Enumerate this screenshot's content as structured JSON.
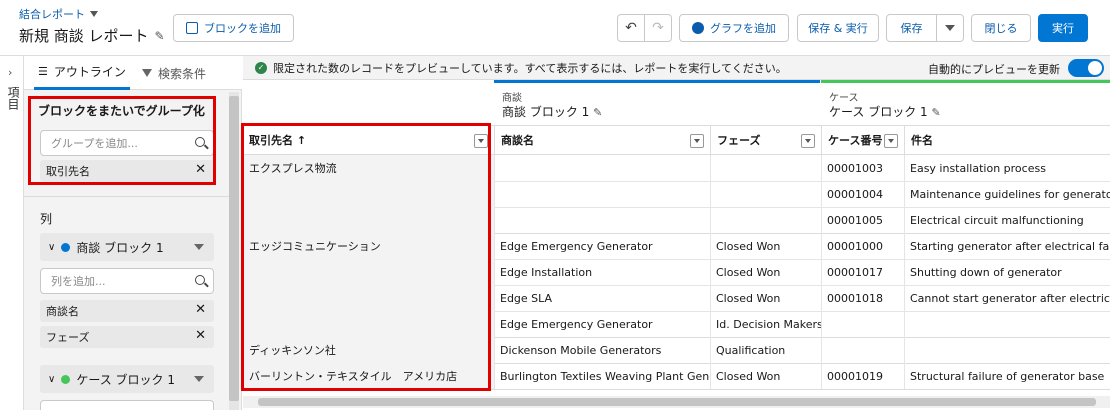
{
  "header": {
    "breadcrumb": "結合レポート",
    "title": "新規 商談 レポート",
    "add_block_label": "ブロックを追加",
    "add_chart_label": "グラフを追加",
    "save_run_label": "保存 & 実行",
    "save_label": "保存",
    "close_label": "閉じる",
    "run_label": "実行"
  },
  "left_strip": {
    "label": "項目"
  },
  "panel": {
    "tabs": [
      "アウトライン",
      "検索条件"
    ],
    "group_section_title": "ブロックをまたいでグループ化",
    "group_input_placeholder": "グループを追加...",
    "group_pills": [
      "取引先名"
    ],
    "columns_title": "列",
    "blocks": [
      {
        "name": "商談 ブロック 1",
        "color": "#0176d3",
        "input_placeholder": "列を追加...",
        "columns": [
          "商談名",
          "フェーズ"
        ]
      },
      {
        "name": "ケース ブロック 1",
        "color": "#45c65a",
        "input_placeholder": "列を追加...",
        "columns": []
      }
    ]
  },
  "notice": {
    "text": "限定された数のレコードをプレビューしています。すべて表示するには、レポートを実行してください。",
    "auto_preview_label": "自動的にプレビューを更新"
  },
  "report": {
    "blocks": [
      {
        "type": "商談",
        "name": "商談 ブロック 1",
        "color": "#0176d3"
      },
      {
        "type": "ケース",
        "name": "ケース ブロック 1",
        "color": "#45c65a"
      }
    ],
    "columns": [
      "取引先名 ↑",
      "商談名",
      "フェーズ",
      "ケース番号",
      "件名"
    ],
    "groups": [
      {
        "account": "エクスプレス物流",
        "opps": [],
        "cases": [
          [
            "00001003",
            "Easy installation process"
          ],
          [
            "00001004",
            "Maintenance guidelines for generator un"
          ],
          [
            "00001005",
            "Electrical circuit malfunctioning"
          ]
        ]
      },
      {
        "account": "エッジコミュニケーション",
        "opps": [
          [
            "Edge Emergency Generator",
            "Closed Won"
          ],
          [
            "Edge Installation",
            "Closed Won"
          ],
          [
            "Edge SLA",
            "Closed Won"
          ],
          [
            "Edge Emergency Generator",
            "Id. Decision Makers"
          ]
        ],
        "cases": [
          [
            "00001000",
            "Starting generator after electrical failure"
          ],
          [
            "00001017",
            "Shutting down of generator"
          ],
          [
            "00001018",
            "Cannot start generator after electrical fai"
          ]
        ]
      },
      {
        "account": "ディッキンソン社",
        "opps": [
          [
            "Dickenson Mobile Generators",
            "Qualification"
          ]
        ],
        "cases": []
      },
      {
        "account": "バーリントン・テキスタイル　アメリカ店",
        "opps": [
          [
            "Burlington Textiles Weaving Plant Generator",
            "Closed Won"
          ]
        ],
        "cases": [
          [
            "00001019",
            "Structural failure of generator base"
          ]
        ]
      }
    ]
  }
}
